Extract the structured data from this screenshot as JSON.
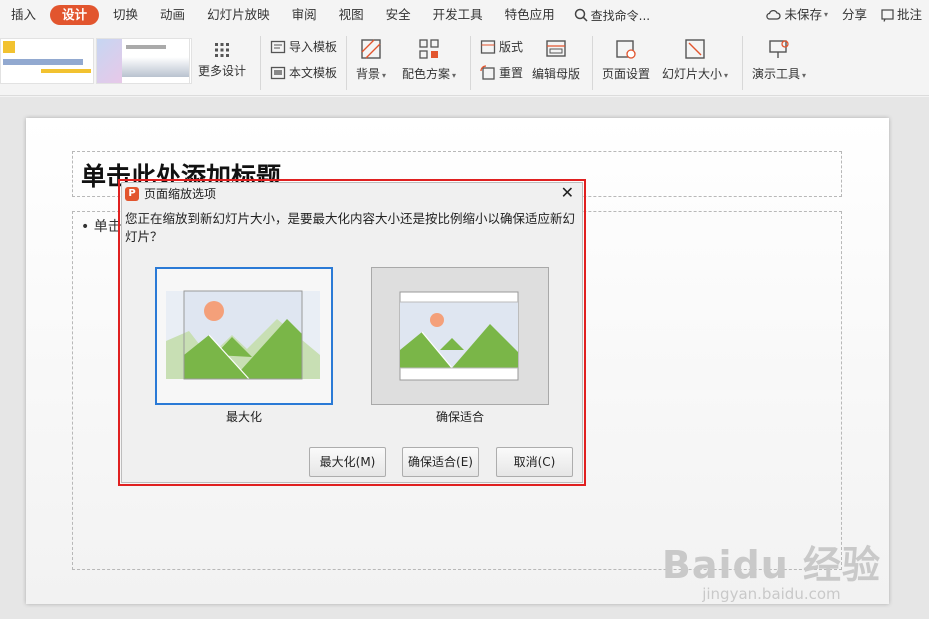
{
  "menubar": {
    "items": [
      "插入",
      "设计",
      "切换",
      "动画",
      "幻灯片放映",
      "审阅",
      "视图",
      "安全",
      "开发工具",
      "特色应用"
    ],
    "active_index": 1,
    "search_label": "查找命令...",
    "right": [
      "未保存",
      "分享",
      "批注"
    ]
  },
  "ribbon": {
    "more_design": "更多设计",
    "import_template": "导入模板",
    "text_template": "本文模板",
    "background": "背景",
    "color_scheme": "配色方案",
    "layout": "版式",
    "reset": "重置",
    "edit_master": "编辑母版",
    "page_setup": "页面设置",
    "slide_size": "幻灯片大小",
    "presentation_tools": "演示工具"
  },
  "slide": {
    "title_placeholder": "单击此处添加标题",
    "body_placeholder": "• 单击"
  },
  "dialog": {
    "title": "页面缩放选项",
    "message": "您正在缩放到新幻灯片大小，是要最大化内容大小还是按比例缩小以确保适应新幻灯片？",
    "option_maximize": "最大化",
    "option_fit": "确保适合",
    "btn_maximize": "最大化(M)",
    "btn_fit": "确保适合(E)",
    "btn_cancel": "取消(C)"
  },
  "watermark": {
    "main": "Baidu 经验",
    "sub": "jingyan.baidu.com"
  },
  "colors": {
    "accent": "#e2552e",
    "selection": "#2a7ad6",
    "highlight": "#e02020",
    "mountain": "#7ab648",
    "sun": "#f4a07a"
  }
}
